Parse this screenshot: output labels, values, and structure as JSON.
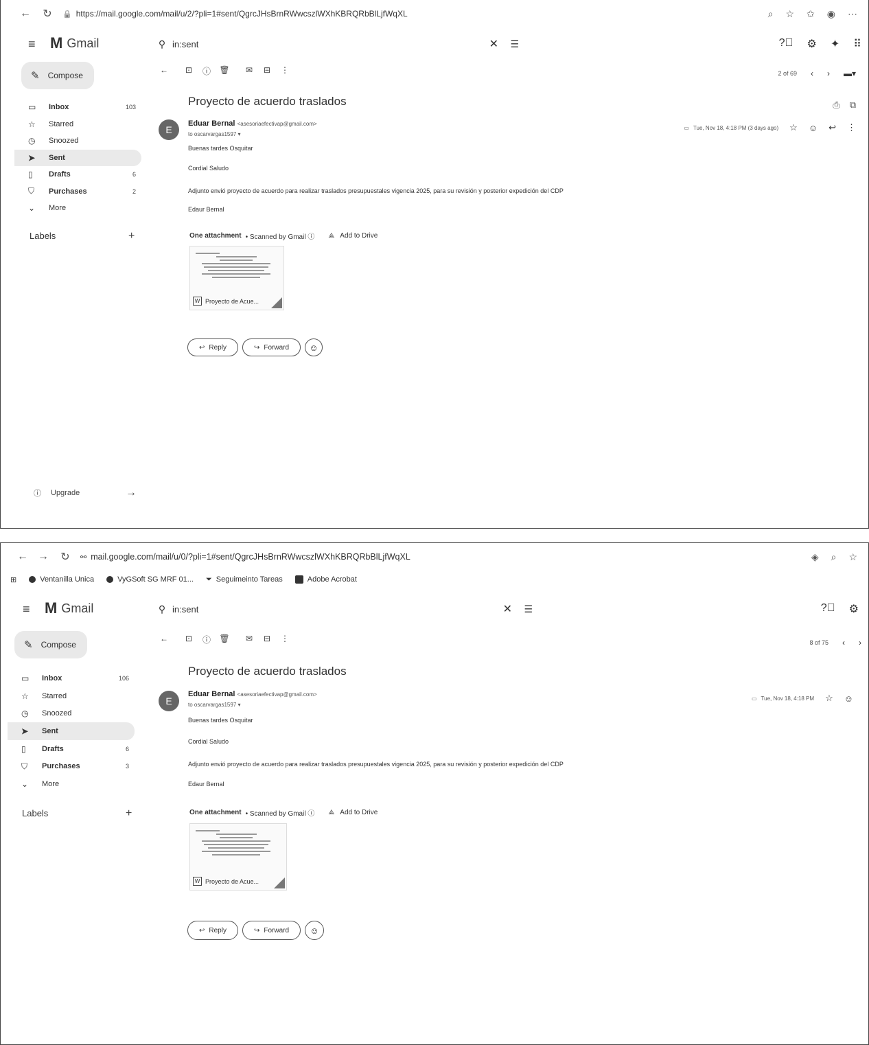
{
  "shot1": {
    "url": "https://mail.google.com/mail/u/2/?pli=1#sent/QgrcJHsBrnRWwcszlWXhKBRQRbBlLjfWqXL",
    "app_name": "Gmail",
    "search_query": "in:sent",
    "compose_label": "Compose",
    "nav": [
      {
        "label": "Inbox",
        "count": "103",
        "icon": "inbox-icon"
      },
      {
        "label": "Starred",
        "count": "",
        "icon": "star-icon"
      },
      {
        "label": "Snoozed",
        "count": "",
        "icon": "clock-icon"
      },
      {
        "label": "Sent",
        "count": "",
        "icon": "send-icon"
      },
      {
        "label": "Drafts",
        "count": "6",
        "icon": "draft-icon"
      },
      {
        "label": "Purchases",
        "count": "2",
        "icon": "bag-icon"
      },
      {
        "label": "More",
        "count": "",
        "icon": "chevron-down-icon"
      }
    ],
    "labels_title": "Labels",
    "upgrade_label": "Upgrade",
    "pager": "2 of 69",
    "subject": "Proyecto de acuerdo traslados",
    "sender_name": "Eduar Bernal",
    "sender_email": "<asesoriaefectivap@gmail.com>",
    "avatar_letter": "E",
    "to_line": "to oscarvargas1597 ▾",
    "date": "Tue, Nov 18, 4:18 PM (3 days ago)",
    "body": [
      "Buenas tardes Osquitar",
      "Cordial Saludo",
      "Adjunto envió proyecto de acuerdo para realizar traslados presupuestales vigencia 2025, para su revisión y posterior expedición del CDP",
      "Edaur Bernal"
    ],
    "attachment_heading": "One attachment",
    "scanned": "• Scanned by Gmail ⓘ",
    "add_to_drive": "Add to Drive",
    "attachment_name": "Proyecto de Acue...",
    "reply_label": "Reply",
    "forward_label": "Forward"
  },
  "shot2": {
    "url": "mail.google.com/mail/u/0/?pli=1#sent/QgrcJHsBrnRWwcszlWXhKBRQRbBlLjfWqXL",
    "bookmarks": [
      "Ventanilla Unica",
      "VyGSoft SG MRF 01...",
      "Seguimeinto Tareas",
      "Adobe Acrobat"
    ],
    "app_name": "Gmail",
    "search_query": "in:sent",
    "compose_label": "Compose",
    "nav": [
      {
        "label": "Inbox",
        "count": "106",
        "icon": "inbox-icon"
      },
      {
        "label": "Starred",
        "count": "",
        "icon": "star-icon"
      },
      {
        "label": "Snoozed",
        "count": "",
        "icon": "clock-icon"
      },
      {
        "label": "Sent",
        "count": "",
        "icon": "send-icon"
      },
      {
        "label": "Drafts",
        "count": "6",
        "icon": "draft-icon"
      },
      {
        "label": "Purchases",
        "count": "3",
        "icon": "bag-icon"
      },
      {
        "label": "More",
        "count": "",
        "icon": "chevron-down-icon"
      }
    ],
    "labels_title": "Labels",
    "pager": "8 of 75",
    "subject": "Proyecto de acuerdo traslados",
    "sender_name": "Eduar Bernal",
    "sender_email": "<asesoriaefectivap@gmail.com>",
    "avatar_letter": "E",
    "to_line": "to oscarvargas1597 ▾",
    "date": "Tue, Nov 18, 4:18 PM",
    "body": [
      "Buenas tardes Osquitar",
      "Cordial Saludo",
      "Adjunto envió proyecto de acuerdo para realizar traslados presupuestales vigencia 2025, para su revisión y posterior expedición del CDP",
      "Edaur Bernal"
    ],
    "attachment_heading": "One attachment",
    "scanned": "• Scanned by Gmail ⓘ",
    "add_to_drive": "Add to Drive",
    "attachment_name": "Proyecto de Acue...",
    "reply_label": "Reply",
    "forward_label": "Forward"
  }
}
